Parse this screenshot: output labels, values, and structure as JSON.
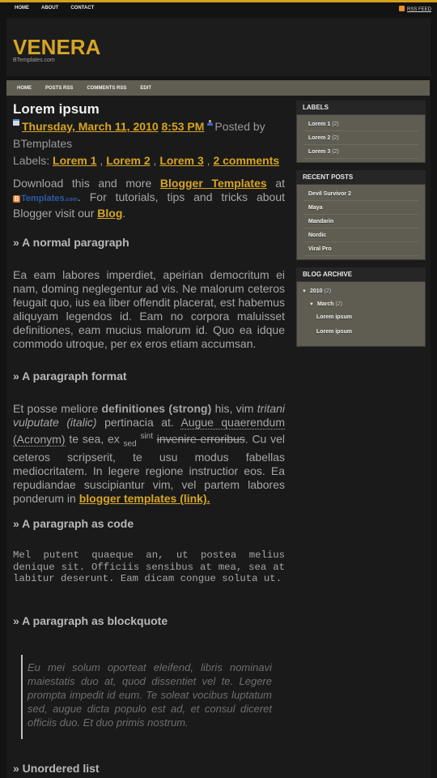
{
  "topnav": {
    "items": [
      "HOME",
      "ABOUT",
      "CONTACT"
    ],
    "rss_label": "RSS FEED"
  },
  "site": {
    "title": "VENERA",
    "subtitle": "BTemplates.com"
  },
  "mainnav": {
    "items": [
      "HOME",
      "POSTS RSS",
      "COMMENTS RSS",
      "EDIT"
    ]
  },
  "post": {
    "title": "Lorem ipsum",
    "date": "Thursday, March 11, 2010",
    "time": "8:53 PM",
    "posted_by_prefix": "Posted by",
    "author": "BTemplates",
    "labels_prefix": "Labels:",
    "labels": [
      "Lorem 1",
      "Lorem 2",
      "Lorem 3"
    ],
    "comments": "2 comments",
    "download": {
      "before": "Download this and more",
      "link": "Blogger Templates",
      "after_link": "at",
      "logo_b": "B",
      "logo_text": "Templates",
      "logo_small": ".com",
      "mid": ". For tutorials, tips and tricks about Blogger visit our",
      "blog_link": "Blog",
      "end": "."
    },
    "sections": {
      "normal": {
        "heading": "» A normal paragraph",
        "text": "Ea eam labores imperdiet, apeirian democritum ei nam, doming neglegentur ad vis. Ne malorum ceteros feugait quo, ius ea liber offendit placerat, est habemus aliquyam legendos id. Eam no corpora maluisset definitiones, eam mucius malorum id. Quo ea idque commodo utroque, per ex eros etiam accumsan."
      },
      "format": {
        "heading": "» A paragraph format",
        "t1": "Et posse meliore",
        "strong": "definitiones (strong)",
        "t2": "his, vim",
        "italic": "tritani vulputate (italic)",
        "t3": "pertinacia at.",
        "acronym": "Augue quaerendum (Acronym)",
        "t4": "te sea, ex",
        "sub": "sed",
        "sup": "sint",
        "del": "invenire erroribus",
        "t5": ". Cu vel ceteros scripserit, te usu modus fabellas mediocritatem. In legere regione instructior eos. Ea repudiandae suscipiantur vim, vel partem labores ponderum in",
        "link": "blogger templates (link)."
      },
      "code": {
        "heading": "» A paragraph as code",
        "text": "Mel putent quaeque an, ut postea melius denique sit. Officiis sensibus at mea, sea at labitur deserunt. Eam dicam congue soluta ut."
      },
      "blockquote": {
        "heading": "» A paragraph as blockquote",
        "text": "Eu mei solum oporteat eleifend, libris nominavi maiestatis duo at, quod dissentiet vel te. Legere prompta impedit id eum. Te soleat vocibus luptatum sed, augue dicta populo est ad, et consul diceret officiis duo. Et duo primis nostrum."
      },
      "list": {
        "heading": "» Unordered list"
      }
    }
  },
  "sidebar": {
    "labels": {
      "title": "LABELS",
      "items": [
        {
          "name": "Lorem 1",
          "count": "(2)"
        },
        {
          "name": "Lorem 2",
          "count": "(2)"
        },
        {
          "name": "Lorem 3",
          "count": "(2)"
        }
      ]
    },
    "recent": {
      "title": "RECENT POSTS",
      "items": [
        "Devil Survivor 2",
        "Maya",
        "Mandarin",
        "Nordic",
        "Viral Pro"
      ]
    },
    "archive": {
      "title": "BLOG ARCHIVE",
      "year": "2010",
      "year_count": "(2)",
      "month": "March",
      "month_count": "(2)",
      "posts": [
        "Lorem ipsum",
        "Lorem ipsum"
      ],
      "toggle_glyph": "▼"
    }
  },
  "colors": {
    "accent": "#d6a524",
    "nav_bg": "#605e52",
    "widget_bg": "#5f5d51",
    "page_bg": "#1a1a1a"
  }
}
